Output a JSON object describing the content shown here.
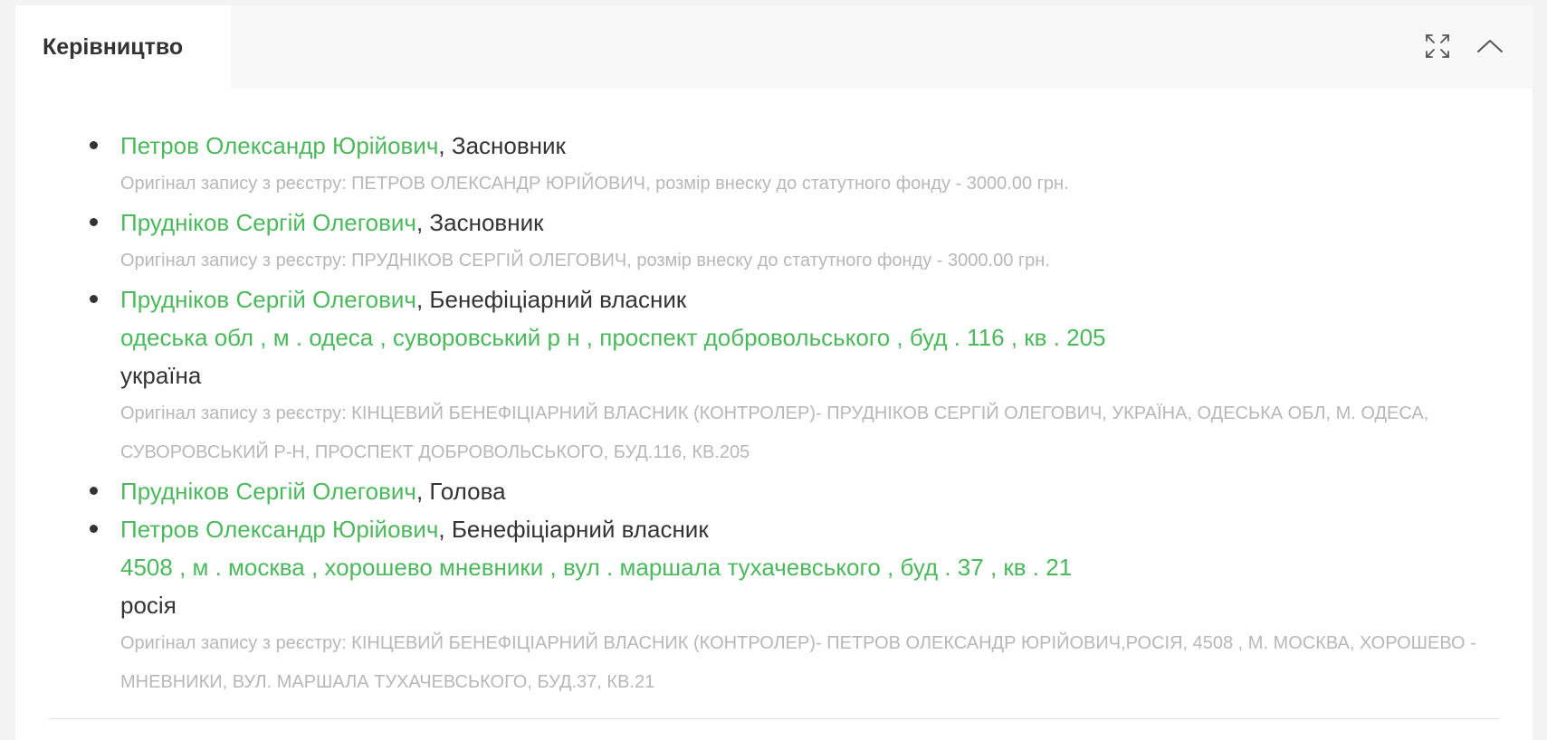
{
  "panel": {
    "title": "Керівництво",
    "icons": [
      "expand-icon",
      "chevron-up-icon"
    ]
  },
  "people": [
    {
      "name": "Петров Олександр Юрійович",
      "role": ", Засновник",
      "address": "",
      "country": "",
      "original": "Оригінал запису з реєстру: ПЕТРОВ ОЛЕКСАНДР ЮРІЙОВИЧ, розмір внеску до статутного фонду - 3000.00 грн."
    },
    {
      "name": "Прудніков Сергій Олегович",
      "role": ", Засновник",
      "address": "",
      "country": "",
      "original": "Оригінал запису з реєстру: ПРУДНІКОВ СЕРГІЙ ОЛЕГОВИЧ, розмір внеску до статутного фонду - 3000.00 грн."
    },
    {
      "name": "Прудніков Сергій Олегович",
      "role": ", Бенефіціарний власник",
      "address": "одеська обл , м . одеса , суворовський р н , проспект добровольського , буд . 116 , кв . 205",
      "country": "україна",
      "original": "Оригінал запису з реєстру: КІНЦЕВИЙ БЕНЕФІЦІАРНИЙ ВЛАСНИК (КОНТРОЛЕР)- ПРУДНІКОВ СЕРГІЙ ОЛЕГОВИЧ, УКРАЇНА, ОДЕСЬКА ОБЛ, М. ОДЕСА, СУВОРОВСЬКИЙ Р-Н, ПРОСПЕКТ ДОБРОВОЛЬСЬКОГО, БУД.116, КВ.205"
    },
    {
      "name": "Прудніков Сергій Олегович",
      "role": ", Голова",
      "address": "",
      "country": "",
      "original": ""
    },
    {
      "name": "Петров Олександр Юрійович",
      "role": ", Бенефіціарний власник",
      "address": "4508 , м . москва , хорошево мневники , вул . маршала тухачевського , буд . 37 , кв . 21",
      "country": "росія",
      "original": "Оригінал запису з реєстру: КІНЦЕВИЙ БЕНЕФІЦІАРНИЙ ВЛАСНИК (КОНТРОЛЕР)- ПЕТРОВ ОЛЕКСАНДР ЮРІЙОВИЧ,РОСІЯ, 4508 , М. МОСКВА, ХОРОШЕВО - МНЕВНИКИ, ВУЛ. МАРШАЛА ТУХАЧЕВСЬКОГО, БУД.37, КВ.21"
    }
  ],
  "colors": {
    "link": "#4cb85c",
    "text": "#333333",
    "muted": "#b7b7b7",
    "header_bg": "#f8f8f8",
    "page_bg": "#f3f3f3"
  }
}
